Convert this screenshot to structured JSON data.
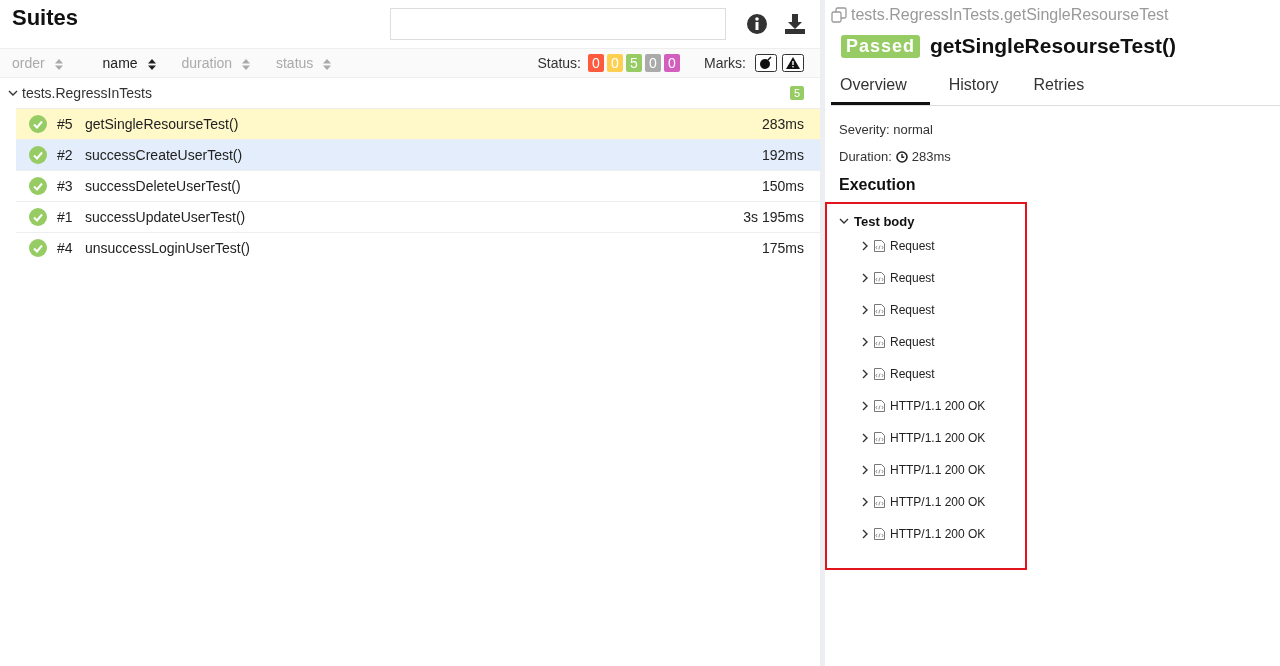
{
  "left": {
    "title": "Suites",
    "sort_columns": [
      {
        "label": "order",
        "selected": false
      },
      {
        "label": "name",
        "selected": true
      },
      {
        "label": "duration",
        "selected": false
      },
      {
        "label": "status",
        "selected": false
      }
    ],
    "status_label": "Status:",
    "status_counts": [
      {
        "count": "0",
        "color": "#fd5a3e"
      },
      {
        "count": "0",
        "color": "#ffd050"
      },
      {
        "count": "5",
        "color": "#97cc64"
      },
      {
        "count": "0",
        "color": "#aaaaaa"
      },
      {
        "count": "0",
        "color": "#d35ebe"
      }
    ],
    "marks_label": "Marks:",
    "group": {
      "name": "tests.RegressInTests",
      "expanded": true,
      "count": "5"
    },
    "rows": [
      {
        "number": "#5",
        "name": "getSingleResourseTest()",
        "duration": "283ms",
        "selected": true,
        "hovered": false
      },
      {
        "number": "#2",
        "name": "successCreateUserTest()",
        "duration": "192ms",
        "selected": false,
        "hovered": true
      },
      {
        "number": "#3",
        "name": "successDeleteUserTest()",
        "duration": "150ms",
        "selected": false,
        "hovered": false
      },
      {
        "number": "#1",
        "name": "successUpdateUserTest()",
        "duration": "3s 195ms",
        "selected": false,
        "hovered": false
      },
      {
        "number": "#4",
        "name": "unsuccessLoginUserTest()",
        "duration": "175ms",
        "selected": false,
        "hovered": false
      }
    ]
  },
  "right": {
    "full_name": "tests.RegressInTests.getSingleResourseTest",
    "status": "Passed",
    "title": "getSingleResourseTest()",
    "tabs": [
      {
        "label": "Overview",
        "selected": true
      },
      {
        "label": "History",
        "selected": false
      },
      {
        "label": "Retries",
        "selected": false
      }
    ],
    "severity": "Severity: normal",
    "duration_label": "Duration:",
    "duration": "283ms",
    "section": "Execution",
    "step": {
      "name": "Test body",
      "expanded": true,
      "children": [
        {
          "name": "Request",
          "expanded": false
        },
        {
          "name": "Request",
          "expanded": false
        },
        {
          "name": "Request",
          "expanded": false
        },
        {
          "name": "Request",
          "expanded": false
        },
        {
          "name": "Request",
          "expanded": false
        },
        {
          "name": "HTTP/1.1 200 OK",
          "expanded": false
        },
        {
          "name": "HTTP/1.1 200 OK",
          "expanded": false
        },
        {
          "name": "HTTP/1.1 200 OK",
          "expanded": false
        },
        {
          "name": "HTTP/1.1 200 OK",
          "expanded": false
        },
        {
          "name": "HTTP/1.1 200 OK",
          "expanded": false
        }
      ]
    }
  }
}
